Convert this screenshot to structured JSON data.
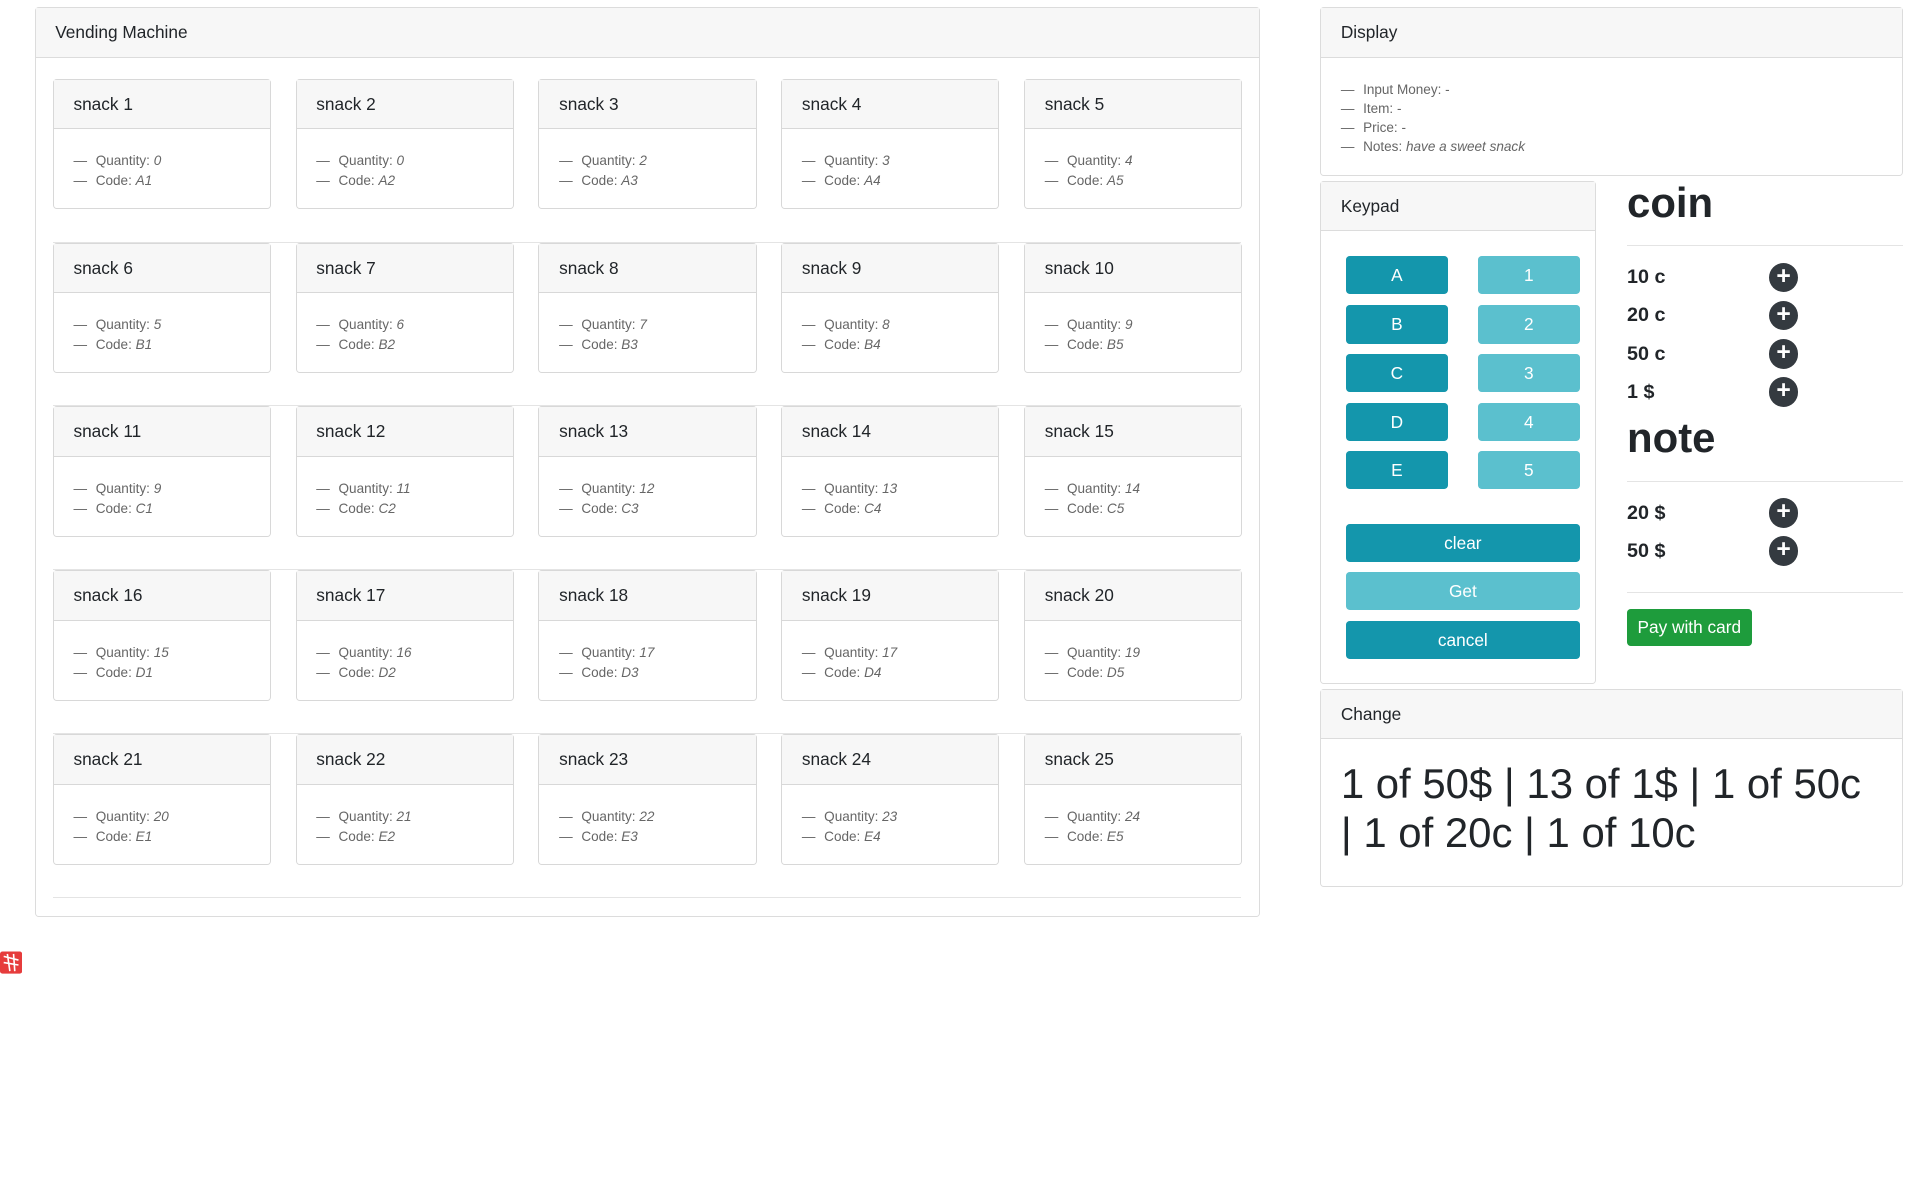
{
  "vending_machine": {
    "title": "Vending Machine",
    "labels": {
      "quantity": "Quantity:",
      "code": "Code:"
    },
    "snacks": [
      {
        "name": "snack 1",
        "quantity": "0",
        "code": "A1"
      },
      {
        "name": "snack 2",
        "quantity": "0",
        "code": "A2"
      },
      {
        "name": "snack 3",
        "quantity": "2",
        "code": "A3"
      },
      {
        "name": "snack 4",
        "quantity": "3",
        "code": "A4"
      },
      {
        "name": "snack 5",
        "quantity": "4",
        "code": "A5"
      },
      {
        "name": "snack 6",
        "quantity": "5",
        "code": "B1"
      },
      {
        "name": "snack 7",
        "quantity": "6",
        "code": "B2"
      },
      {
        "name": "snack 8",
        "quantity": "7",
        "code": "B3"
      },
      {
        "name": "snack 9",
        "quantity": "8",
        "code": "B4"
      },
      {
        "name": "snack 10",
        "quantity": "9",
        "code": "B5"
      },
      {
        "name": "snack 11",
        "quantity": "9",
        "code": "C1"
      },
      {
        "name": "snack 12",
        "quantity": "11",
        "code": "C2"
      },
      {
        "name": "snack 13",
        "quantity": "12",
        "code": "C3"
      },
      {
        "name": "snack 14",
        "quantity": "13",
        "code": "C4"
      },
      {
        "name": "snack 15",
        "quantity": "14",
        "code": "C5"
      },
      {
        "name": "snack 16",
        "quantity": "15",
        "code": "D1"
      },
      {
        "name": "snack 17",
        "quantity": "16",
        "code": "D2"
      },
      {
        "name": "snack 18",
        "quantity": "17",
        "code": "D3"
      },
      {
        "name": "snack 19",
        "quantity": "17",
        "code": "D4"
      },
      {
        "name": "snack 20",
        "quantity": "19",
        "code": "D5"
      },
      {
        "name": "snack 21",
        "quantity": "20",
        "code": "E1"
      },
      {
        "name": "snack 22",
        "quantity": "21",
        "code": "E2"
      },
      {
        "name": "snack 23",
        "quantity": "22",
        "code": "E3"
      },
      {
        "name": "snack 24",
        "quantity": "23",
        "code": "E4"
      },
      {
        "name": "snack 25",
        "quantity": "24",
        "code": "E5"
      }
    ]
  },
  "display": {
    "title": "Display",
    "input_money_label": "Input Money:",
    "input_money_value": "-",
    "item_label": "Item:",
    "item_value": "-",
    "price_label": "Price:",
    "price_value": "-",
    "notes_label": "Notes:",
    "notes_value": "have a sweet snack"
  },
  "keypad": {
    "title": "Keypad",
    "letters": [
      "A",
      "B",
      "C",
      "D",
      "E"
    ],
    "numbers": [
      "1",
      "2",
      "3",
      "4",
      "5"
    ],
    "clear_label": "clear",
    "get_label": "Get",
    "cancel_label": "cancel"
  },
  "coins": {
    "title": "coin",
    "items": [
      "10 c",
      "20 c",
      "50 c",
      "1 $"
    ],
    "add_icon": "plus-circle-icon"
  },
  "notes": {
    "title": "note",
    "items": [
      "20 $",
      "50 $"
    ]
  },
  "pay_with_card_label": "Pay with card",
  "change": {
    "title": "Change",
    "text": "1 of 50$ | 13 of 1$ | 1 of 50c | 1 of 20c | 1 of 10c"
  },
  "colors": {
    "key_dark": "#1496ac",
    "key_light": "#5bc0ce",
    "pay_green": "#1e9c3c",
    "plus_dark": "#343a40"
  }
}
